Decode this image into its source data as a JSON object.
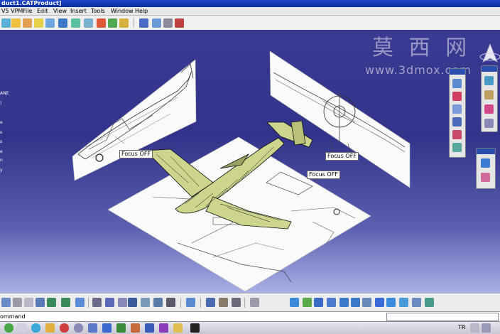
{
  "window": {
    "title": "duct1.CATProduct]"
  },
  "menu": [
    {
      "label": "V5 VPM"
    },
    {
      "label": "File"
    },
    {
      "label": "Edit"
    },
    {
      "label": "View"
    },
    {
      "label": "Insert"
    },
    {
      "label": "Tools"
    },
    {
      "label": "Window"
    },
    {
      "label": "Help"
    }
  ],
  "tree_fragments": [
    "ANE",
    ")",
    "e",
    "s",
    "s",
    "e",
    "n",
    "y"
  ],
  "viewport": {
    "focus_labels": [
      "Focus OFF",
      "Focus OFF",
      "Focus OFF"
    ]
  },
  "watermark": {
    "cn": "莫 西 网",
    "en": "www.3dmox.com"
  },
  "command": {
    "label": "ommand",
    "value": ""
  },
  "taskbar": {
    "lang": "TR"
  },
  "colors": {
    "viewport_top": "#3a3a92",
    "viewport_bottom": "#a9b0e6",
    "model": "#cdd48c"
  }
}
